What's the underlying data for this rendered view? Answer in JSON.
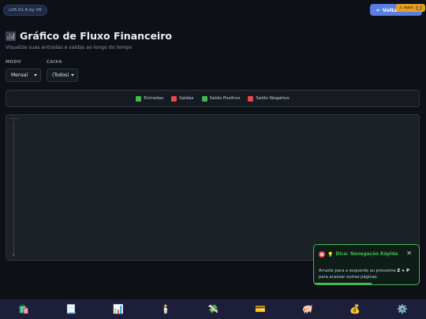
{
  "header": {
    "version": "v26.01.6 by V6",
    "back_label": "← Voltar",
    "warn_label": "⚠ warn",
    "warn_count": "1"
  },
  "page": {
    "title": "Gráfico de Fluxo Financeiro",
    "subtitle": "Visualize suas entradas e saídas ao longo do tempo"
  },
  "filters": {
    "modo_label": "MODO",
    "modo_value": "Mensal",
    "caixa_label": "CAIXA",
    "caixa_value": "(Todos)"
  },
  "legend": [
    {
      "label": "Entradas",
      "color": "#3fb950"
    },
    {
      "label": "Saídas",
      "color": "#e5484d"
    },
    {
      "label": "Saldo Positivo",
      "color": "#3fb950"
    },
    {
      "label": "Saldo Negativo",
      "color": "#e5484d"
    }
  ],
  "chart": {
    "top_tick": "",
    "bottom_tick": "0"
  },
  "toast": {
    "title": "Dica: Navegação Rápida",
    "close": "✕",
    "body_prefix": "Arraste para a esquerda ou pressione ",
    "shortcut": "Z + P",
    "body_suffix": " para acessar outras páginas.",
    "progress": 0.55
  },
  "nav": [
    {
      "icon": "shopping-bags-icon",
      "glyph": "🛍️"
    },
    {
      "icon": "document-icon",
      "glyph": "📃"
    },
    {
      "icon": "bar-chart-icon",
      "glyph": "📊"
    },
    {
      "icon": "candle-icon",
      "glyph": "🕯️"
    },
    {
      "icon": "money-wings-icon",
      "glyph": "💸"
    },
    {
      "icon": "credit-card-icon",
      "glyph": "💳"
    },
    {
      "icon": "piggy-bank-icon",
      "glyph": "🐖"
    },
    {
      "icon": "money-bag-icon",
      "glyph": "💰"
    },
    {
      "icon": "gear-icon",
      "glyph": "⚙️"
    }
  ]
}
